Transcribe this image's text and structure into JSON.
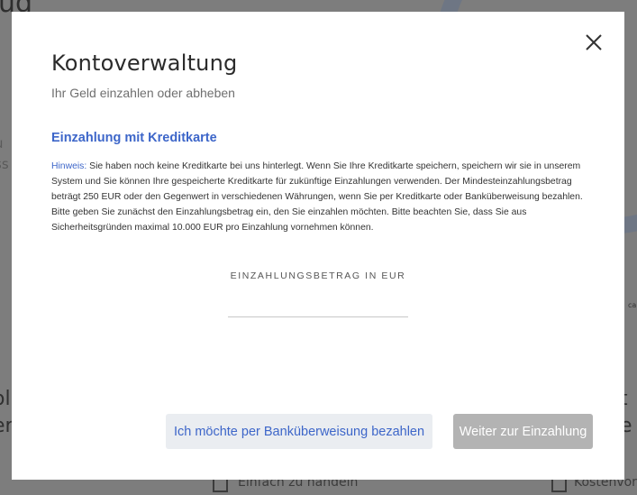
{
  "background": {
    "title_fragment": "ug",
    "left_fragments": [
      "u",
      "ss",
      "ol",
      "er"
    ],
    "right_fragments": [
      "t",
      "e",
      "ca"
    ],
    "bottom_items": [
      "Einfach zu handeln",
      "Kostenvort"
    ]
  },
  "modal": {
    "close_icon": "close-x-icon",
    "title": "Kontoverwaltung",
    "subtitle": "Ihr Geld einzahlen oder abheben",
    "section_title": "Einzahlung mit Kreditkarte",
    "notice_label": "Hinweis:",
    "notice_text": " Sie haben noch keine Kreditkarte bei uns hinterlegt. Wenn Sie Ihre Kreditkarte speichern, speichern wir sie in unserem System und Sie können Ihre gespeicherte Kreditkarte für zukünftige Einzahlungen verwenden. Der Mindesteinzahlungsbetrag beträgt 250 EUR oder den Gegenwert in verschiedenen Währungen, wenn Sie per Kreditkarte oder Banküberweisung bezahlen. Bitte geben Sie zunächst den Einzahlungsbetrag ein, den Sie einzahlen möchten. Bitte beachten Sie, dass Sie aus Sicherheitsgründen maximal 10.000 EUR pro Einzahlung vornehmen können.",
    "amount_label": "EINZAHLUNGSBETRAG IN EUR",
    "amount_value": "",
    "bank_transfer_button": "Ich möchte per Banküberweisung bezahlen",
    "continue_button": "Weiter zur Einzahlung"
  },
  "colors": {
    "accent": "#3d66c9",
    "overlay": "#7d7d7d",
    "disabled_button": "#b3b3b3",
    "secondary_button": "#eaedf1"
  }
}
